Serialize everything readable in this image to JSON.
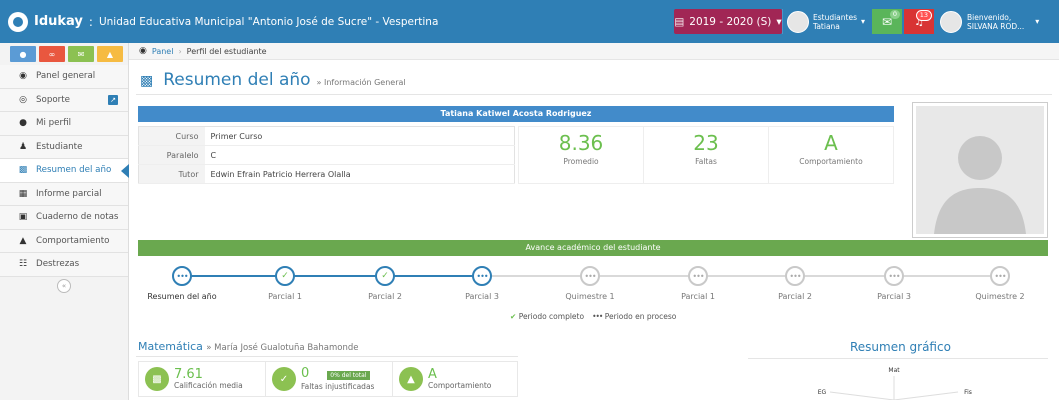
{
  "header": {
    "brand": "Idukay",
    "separator": ":",
    "school": "Unidad Educativa Municipal \"Antonio José de Sucre\" - Vespertina",
    "period": "2019 - 2020 (S)",
    "role": "Estudiantes",
    "student_name": "Tatiana",
    "messages_count": "0",
    "notifications_count": "13",
    "welcome_label": "Bienvenido,",
    "welcome_user": "SILVANA ROD...",
    "colors": {
      "bar": "#2f7fb5",
      "period": "#a12655",
      "messages": "#5ab55a",
      "notifications": "#d83434"
    }
  },
  "sidebar": {
    "shortcuts": [
      {
        "icon": "user-icon",
        "color": "#5b9bd5"
      },
      {
        "icon": "share-icon",
        "color": "#e9573f"
      },
      {
        "icon": "mail-icon",
        "color": "#8cc152"
      },
      {
        "icon": "bank-icon",
        "color": "#f6bb42"
      }
    ],
    "items": [
      {
        "label": "Panel general",
        "icon": "dashboard-icon"
      },
      {
        "label": "Soporte",
        "icon": "lifebuoy-icon"
      },
      {
        "label": "Mi perfil",
        "icon": "user-icon"
      },
      {
        "label": "Estudiante",
        "icon": "child-icon"
      },
      {
        "label": "Resumen del año",
        "icon": "bar-chart-icon"
      },
      {
        "label": "Informe parcial",
        "icon": "table-icon"
      },
      {
        "label": "Cuaderno de notas",
        "icon": "book-icon"
      },
      {
        "label": "Comportamiento",
        "icon": "thumbs-up-icon"
      },
      {
        "label": "Destrezas",
        "icon": "sitemap-icon"
      }
    ]
  },
  "breadcrumb": {
    "home": "Panel",
    "current": "Perfil del estudiante"
  },
  "page": {
    "title": "Resumen del año",
    "subtitle": "» Información General"
  },
  "student": {
    "name": "Tatiana Katiwel Acosta Rodriguez",
    "info": [
      {
        "key": "Curso",
        "value": "Primer Curso"
      },
      {
        "key": "Paralelo",
        "value": "C"
      },
      {
        "key": "Tutor",
        "value": "Edwin Efrain Patricio Herrera Olalla"
      }
    ],
    "stats": [
      {
        "value": "8.36",
        "label": "Promedio"
      },
      {
        "value": "23",
        "label": "Faltas"
      },
      {
        "value": "A",
        "label": "Comportamiento"
      }
    ]
  },
  "progress": {
    "title": "Avance académico del estudiante",
    "steps": [
      {
        "label": "Resumen del año",
        "state": "current"
      },
      {
        "label": "Parcial 1",
        "state": "complete"
      },
      {
        "label": "Parcial 2",
        "state": "complete"
      },
      {
        "label": "Parcial 3",
        "state": "in-progress"
      },
      {
        "label": "Quimestre 1",
        "state": "pending"
      },
      {
        "label": "Parcial 1",
        "state": "pending"
      },
      {
        "label": "Parcial 2",
        "state": "pending"
      },
      {
        "label": "Parcial 3",
        "state": "pending"
      },
      {
        "label": "Quimestre 2",
        "state": "pending"
      }
    ],
    "legend_complete": "Periodo completo",
    "legend_in_process": "Periodo en proceso"
  },
  "subject": {
    "name": "Matemática",
    "teacher": "» María José Gualotuña Bahamonde",
    "cards": [
      {
        "value": "7.61",
        "label": "Calificación media",
        "icon": "bar-chart-icon"
      },
      {
        "value": "0",
        "label": "Faltas injustificadas",
        "icon": "check-icon",
        "badge": "0% del total"
      },
      {
        "value": "A",
        "label": "Comportamiento",
        "icon": "thumbs-up-icon"
      }
    ]
  },
  "chart": {
    "title": "Resumen gráfico",
    "axis_labels": [
      "Mat",
      "Fis",
      "EG"
    ]
  }
}
